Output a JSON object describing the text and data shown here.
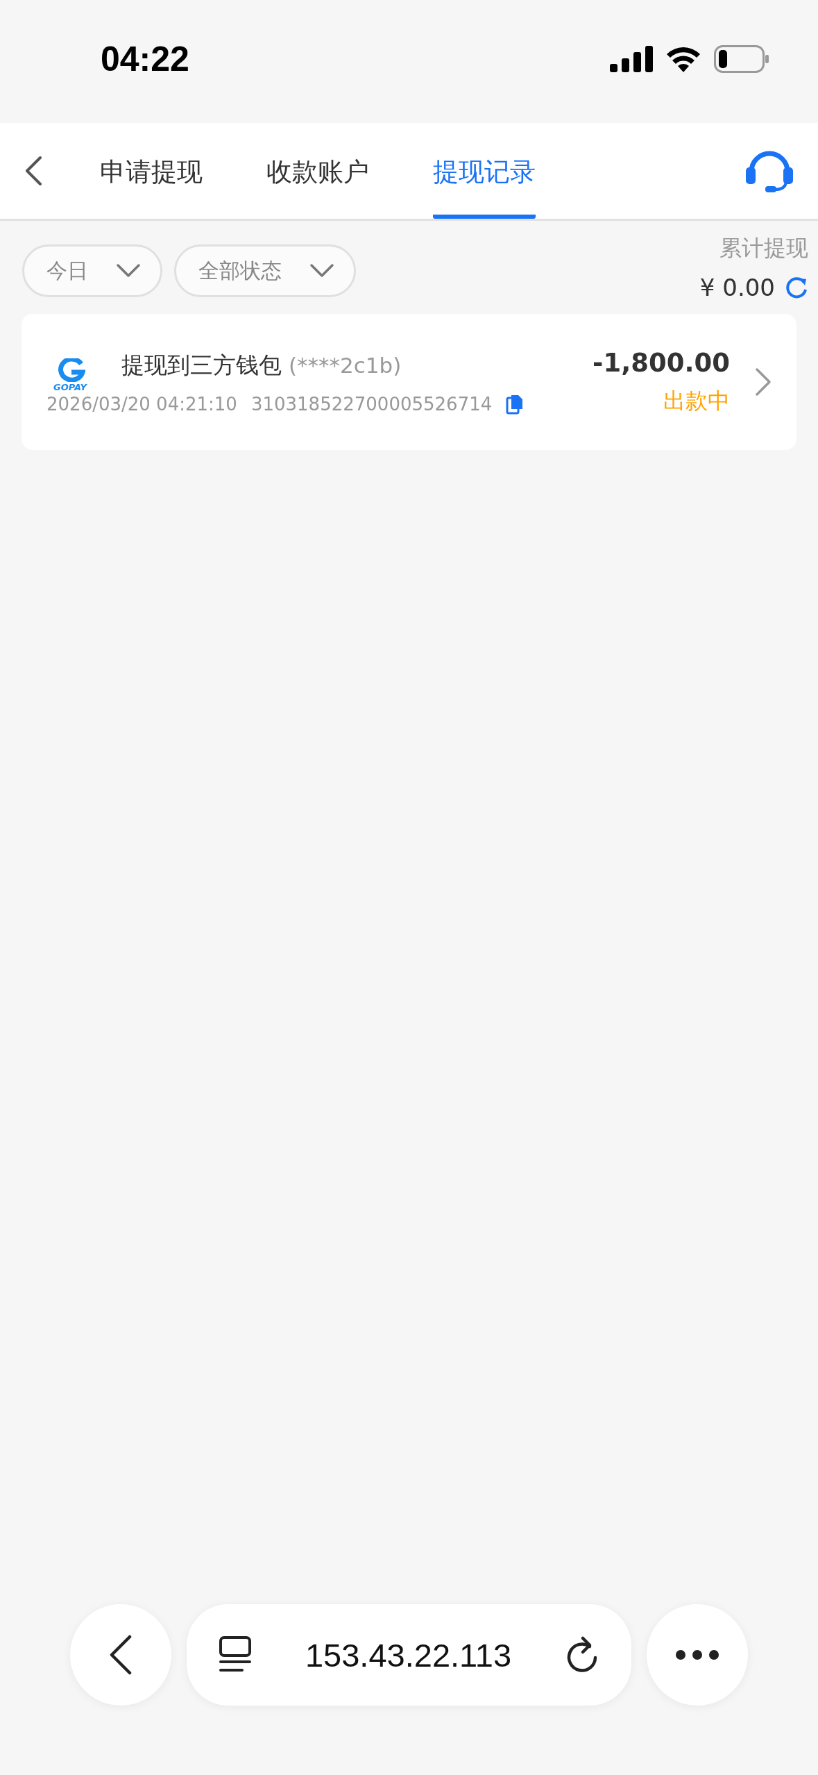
{
  "status_bar": {
    "time": "04:22"
  },
  "tabs": [
    {
      "label": "申请提现",
      "selected": false
    },
    {
      "label": "收款账户",
      "selected": false
    },
    {
      "label": "提现记录",
      "selected": true
    }
  ],
  "filters": [
    {
      "label": "今日"
    },
    {
      "label": "全部状态"
    }
  ],
  "total": {
    "label": "累计提现",
    "amount": "¥ 0.00"
  },
  "records": [
    {
      "logo_text": "GOPAY",
      "title": "提现到三方钱包",
      "account": "(****2c1b)",
      "datetime": "2026/03/20 04:21:10",
      "order_no": "310318522700005526714",
      "amount": "-1,800.00",
      "status": "出款中",
      "color": "#ffa200"
    }
  ],
  "browser_bar": {
    "url": "153.43.22.113"
  }
}
